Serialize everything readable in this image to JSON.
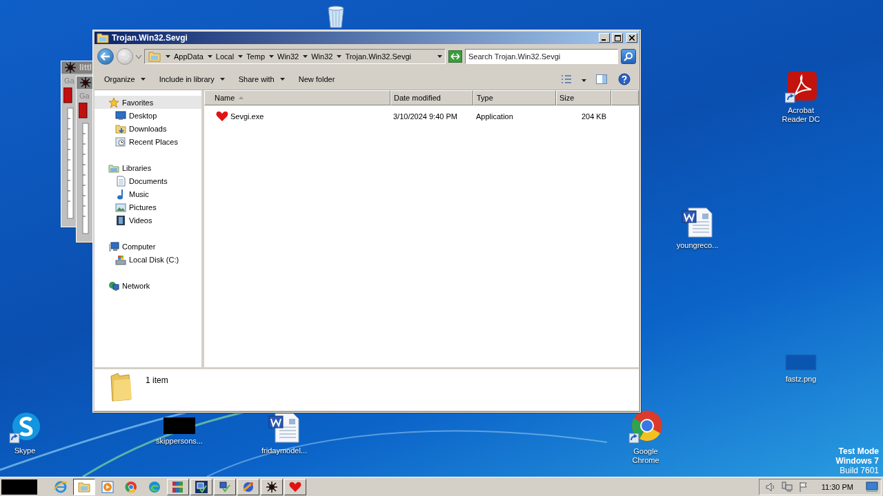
{
  "desktop_icons": [
    {
      "kind": "recycle-bin"
    },
    {
      "kind": "pdf",
      "label": "Acrobat Reader DC"
    },
    {
      "kind": "word",
      "label": "youngreco..."
    },
    {
      "kind": "blank-image",
      "label": "fastz.png"
    },
    {
      "kind": "skype",
      "label": "Skype"
    },
    {
      "kind": "black-image",
      "label": "skippersons..."
    },
    {
      "kind": "word",
      "label": "fridaymodel..."
    },
    {
      "kind": "chrome",
      "label": "Google Chrome"
    }
  ],
  "background_windows": [
    {
      "title": "littl",
      "menu": "Ga"
    },
    {
      "menu": "Ga"
    }
  ],
  "window": {
    "title": "Trojan.Win32.Sevgi",
    "breadcrumbs": [
      "AppData",
      "Local",
      "Temp",
      "Win32",
      "Win32",
      "Trojan.Win32.Sevgi"
    ],
    "search": {
      "placeholder": "Search Trojan.Win32.Sevgi"
    },
    "toolbar": [
      {
        "label": "Organize",
        "dropdown": true
      },
      {
        "label": "Include in library",
        "dropdown": true
      },
      {
        "label": "Share with",
        "dropdown": true
      },
      {
        "label": "New folder",
        "dropdown": false
      }
    ],
    "sidebar": [
      {
        "label": "Favorites",
        "kind": "star",
        "selected": true,
        "children": [
          {
            "label": "Desktop",
            "kind": "desktop",
            "selected": false
          },
          {
            "label": "Downloads",
            "kind": "downloads",
            "selected": false
          },
          {
            "label": "Recent Places",
            "kind": "recent",
            "selected": false
          }
        ]
      },
      {
        "label": "Libraries",
        "kind": "library",
        "selected": false,
        "children": [
          {
            "label": "Documents",
            "kind": "documents",
            "selected": false
          },
          {
            "label": "Music",
            "kind": "music",
            "selected": false
          },
          {
            "label": "Pictures",
            "kind": "pictures",
            "selected": false
          },
          {
            "label": "Videos",
            "kind": "videos",
            "selected": false
          }
        ]
      },
      {
        "label": "Computer",
        "kind": "computer",
        "selected": false,
        "children": [
          {
            "label": "Local Disk (C:)",
            "kind": "disk",
            "selected": false
          }
        ]
      },
      {
        "label": "Network",
        "kind": "network",
        "selected": false
      }
    ],
    "columns": [
      {
        "label": "Name",
        "sorted": true
      },
      {
        "label": "Date modified",
        "sorted": false
      },
      {
        "label": "Type",
        "sorted": false
      },
      {
        "label": "Size",
        "sorted": false
      }
    ],
    "rows": [
      {
        "name": "Sevgi.exe",
        "date": "3/10/2024 9:40 PM",
        "type": "Application",
        "size": "204 KB"
      }
    ],
    "status": "1 item"
  },
  "watermark": [
    "Test Mode",
    "Windows 7",
    "Build 7601"
  ],
  "taskbar": {
    "items": [
      {
        "kind": "ie",
        "selected": false
      },
      {
        "kind": "explorer",
        "selected": true
      },
      {
        "kind": "media",
        "selected": false
      },
      {
        "kind": "chrome",
        "selected": false
      },
      {
        "kind": "edge",
        "selected": false
      },
      {
        "kind": "winrar",
        "selected": false
      },
      {
        "kind": "app-blue",
        "selected": false
      },
      {
        "kind": "app-check",
        "selected": false
      },
      {
        "kind": "app-globe",
        "selected": false
      },
      {
        "kind": "spider",
        "selected": false
      },
      {
        "kind": "heart",
        "selected": false
      }
    ],
    "clock": "11:30 PM"
  }
}
